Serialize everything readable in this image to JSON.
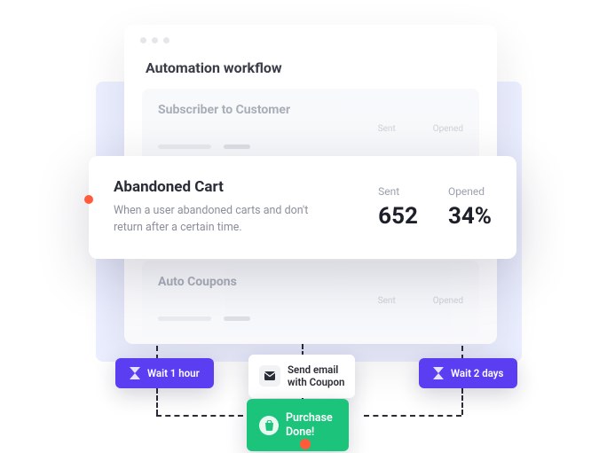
{
  "window": {
    "title": "Automation workflow",
    "items": [
      {
        "title": "Subscriber to Customer",
        "sent_label": "Sent",
        "opened_label": "Opened"
      },
      {
        "title": "Auto Coupons",
        "sent_label": "Sent",
        "opened_label": "Opened"
      }
    ]
  },
  "pop": {
    "title": "Abandoned Cart",
    "desc": "When a user abandoned carts and don't return after a certain time.",
    "metrics": {
      "sent_label": "Sent",
      "sent_value": "652",
      "opened_label": "Opened",
      "opened_value": "34%"
    }
  },
  "chips": {
    "wait_left": "Wait 1 hour",
    "send_email_l1": "Send email",
    "send_email_l2": "with Coupon",
    "wait_right": "Wait 2 days",
    "purchase_l1": "Purchase",
    "purchase_l2": "Done!"
  }
}
